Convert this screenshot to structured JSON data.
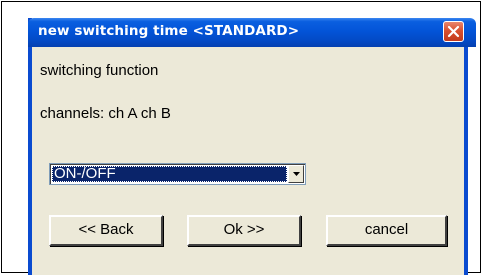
{
  "window": {
    "title": "new switching time <STANDARD>"
  },
  "labels": {
    "switching_function": "switching function",
    "channels": "channels: ch A ch B"
  },
  "dropdown": {
    "selected_value": "ON-/OFF"
  },
  "buttons": {
    "back": "<< Back",
    "ok": "Ok >>",
    "cancel": "cancel"
  },
  "colors": {
    "titlebar": "#0354d8",
    "dialog_background": "#ece9d8",
    "selection_highlight": "#0a246a",
    "close_button": "#d9502f"
  },
  "icons": {
    "close": "close-x-icon",
    "dropdown": "chevron-down-icon"
  }
}
